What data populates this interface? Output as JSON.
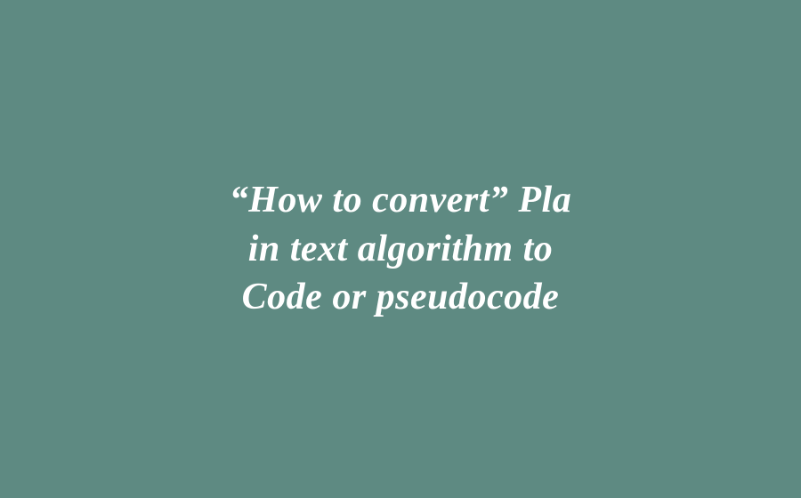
{
  "quote": {
    "line1": "“How to convert” Pla",
    "line2": "in text algorithm to",
    "line3": " Code or pseudocode"
  },
  "colors": {
    "background": "#5e8a82",
    "text": "#ffffff"
  }
}
